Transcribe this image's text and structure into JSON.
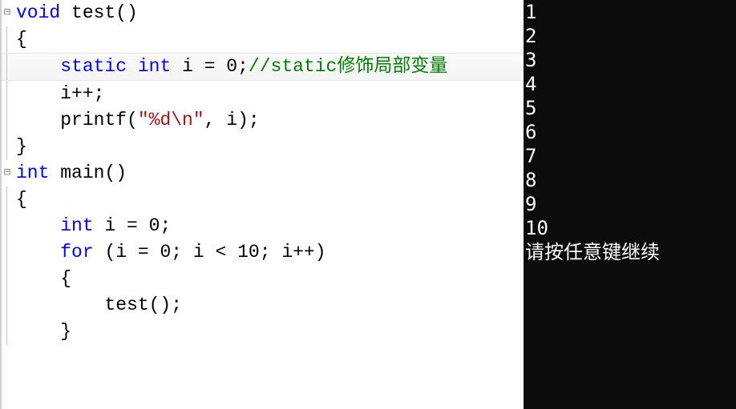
{
  "editor": {
    "lines": [
      {
        "fold": "minus",
        "seg": [
          {
            "t": "void",
            "c": "kw"
          },
          {
            "t": " test()",
            "c": "id"
          }
        ]
      },
      {
        "fold": "line",
        "seg": [
          {
            "t": "{",
            "c": "id"
          }
        ]
      },
      {
        "fold": "line",
        "highlight": true,
        "indent": 1,
        "seg": [
          {
            "t": "static",
            "c": "kw"
          },
          {
            "t": " ",
            "c": "id"
          },
          {
            "t": "int",
            "c": "kw"
          },
          {
            "t": " i = ",
            "c": "id"
          },
          {
            "t": "0",
            "c": "num"
          },
          {
            "t": ";",
            "c": "id"
          },
          {
            "t": "//static修饰局部变量",
            "c": "cmt"
          }
        ]
      },
      {
        "fold": "line",
        "indent": 1,
        "seg": [
          {
            "t": "i++;",
            "c": "id"
          }
        ]
      },
      {
        "fold": "line",
        "indent": 1,
        "seg": [
          {
            "t": "printf(",
            "c": "id"
          },
          {
            "t": "\"%d\\n\"",
            "c": "str"
          },
          {
            "t": ", i);",
            "c": "id"
          }
        ]
      },
      {
        "fold": "line",
        "seg": [
          {
            "t": "}",
            "c": "id"
          }
        ]
      },
      {
        "fold": "",
        "seg": []
      },
      {
        "fold": "minus",
        "seg": [
          {
            "t": "int",
            "c": "kw"
          },
          {
            "t": " main()",
            "c": "id"
          }
        ]
      },
      {
        "fold": "line",
        "seg": [
          {
            "t": "{",
            "c": "id"
          }
        ]
      },
      {
        "fold": "line",
        "indent": 1,
        "seg": [
          {
            "t": "int",
            "c": "kw"
          },
          {
            "t": " i = ",
            "c": "id"
          },
          {
            "t": "0",
            "c": "num"
          },
          {
            "t": ";",
            "c": "id"
          }
        ]
      },
      {
        "fold": "line",
        "indent": 1,
        "seg": [
          {
            "t": "for",
            "c": "kw"
          },
          {
            "t": " (i = ",
            "c": "id"
          },
          {
            "t": "0",
            "c": "num"
          },
          {
            "t": "; i < ",
            "c": "id"
          },
          {
            "t": "10",
            "c": "num"
          },
          {
            "t": "; i++)",
            "c": "id"
          }
        ]
      },
      {
        "fold": "line",
        "indent": 1,
        "seg": [
          {
            "t": "{",
            "c": "id"
          }
        ]
      },
      {
        "fold": "line",
        "indent": 2,
        "seg": [
          {
            "t": "test();",
            "c": "id"
          }
        ]
      },
      {
        "fold": "line",
        "indent": 1,
        "seg": [
          {
            "t": "}",
            "c": "id"
          }
        ]
      }
    ]
  },
  "console": {
    "lines": [
      "1",
      "2",
      "3",
      "4",
      "5",
      "6",
      "7",
      "8",
      "9",
      "10",
      "请按任意键继续"
    ]
  }
}
